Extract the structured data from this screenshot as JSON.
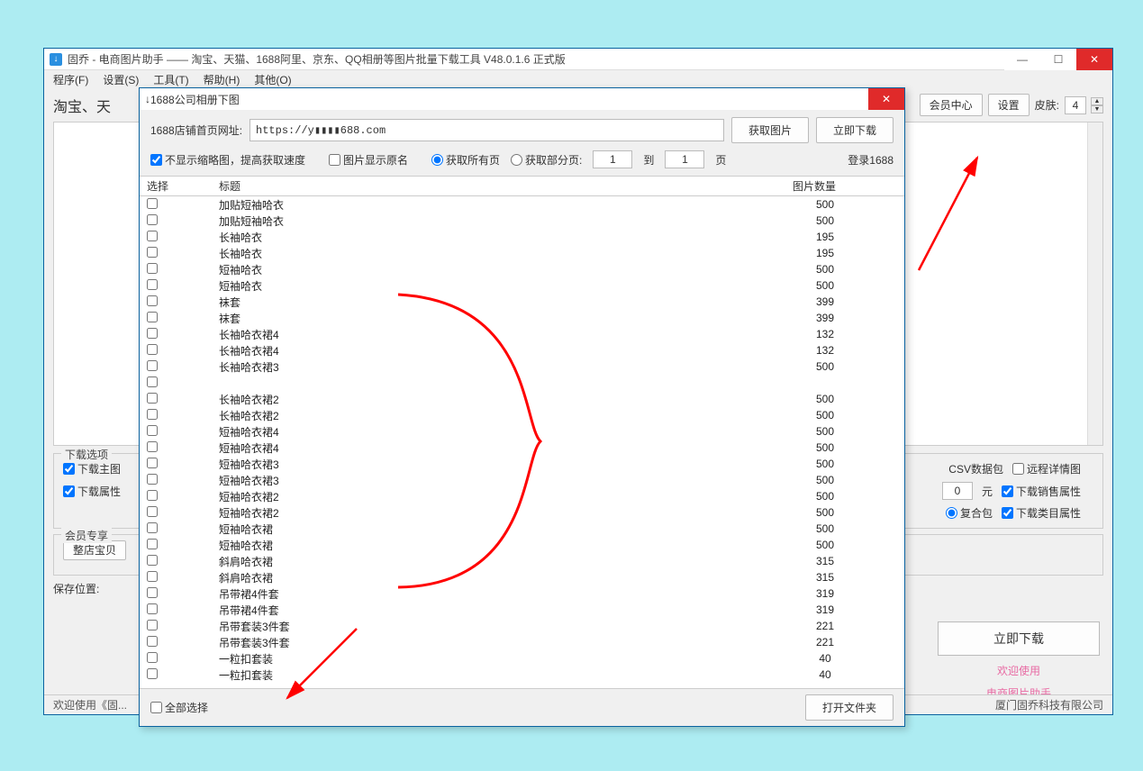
{
  "parent": {
    "title": "固乔 - 电商图片助手 —— 淘宝、天猫、1688阿里、京东、QQ相册等图片批量下载工具 V48.0.1.6 正式版",
    "menu": [
      "程序(F)",
      "设置(S)",
      "工具(T)",
      "帮助(H)",
      "其他(O)"
    ],
    "label_big_prefix": "淘宝、天",
    "toolbar": {
      "member_center": "会员中心",
      "settings": "设置",
      "skin_label": "皮肤:",
      "skin_value": "4"
    },
    "options_group": {
      "title": "下载选项",
      "chk_main": "下载主图",
      "chk_attr": "下载属性",
      "csv_label": "CSV数据包",
      "remote_detail": "远程详情图",
      "price_input": "0",
      "price_unit": "元",
      "dl_sale_attr": "下载销售属性",
      "compound_pack": "复合包",
      "dl_cat_attr": "下载类目属性"
    },
    "member_group": {
      "title": "会员专享",
      "btn_whole_store": "整店宝贝"
    },
    "save_loc_label": "保存位置:",
    "big_download": "立即下载",
    "welcome1": "欢迎使用",
    "welcome2": "电商图片助手",
    "status_left": "欢迎使用《固...",
    "status_right": "厦门固乔科技有限公司"
  },
  "modal": {
    "title": "1688公司相册下图",
    "url_label": "1688店铺首页网址:",
    "url_value": "https://y▮▮▮▮688.com",
    "btn_fetch": "获取图片",
    "btn_download": "立即下载",
    "chk_no_thumb": "不显示缩略图，提高获取速度",
    "chk_show_orig": "图片显示原名",
    "radio_all": "获取所有页",
    "radio_part": "获取部分页:",
    "page_from": "1",
    "to_label": "到",
    "page_to": "1",
    "page_unit": "页",
    "login_link": "登录1688",
    "headers": {
      "select": "选择",
      "title": "标题",
      "count": "图片数量"
    },
    "rows": [
      {
        "title": "加贴短袖哈衣",
        "count": "500"
      },
      {
        "title": "加贴短袖哈衣",
        "count": "500"
      },
      {
        "title": "长袖哈衣",
        "count": "195"
      },
      {
        "title": "长袖哈衣",
        "count": "195"
      },
      {
        "title": "短袖哈衣",
        "count": "500"
      },
      {
        "title": "短袖哈衣",
        "count": "500"
      },
      {
        "title": "袜套",
        "count": "399"
      },
      {
        "title": "袜套",
        "count": "399"
      },
      {
        "title": "长袖哈衣裙4",
        "count": "132"
      },
      {
        "title": "长袖哈衣裙4",
        "count": "132"
      },
      {
        "title": "长袖哈衣裙3",
        "count": "500"
      },
      {
        "title": "",
        "count": ""
      },
      {
        "title": "长袖哈衣裙2",
        "count": "500"
      },
      {
        "title": "长袖哈衣裙2",
        "count": "500"
      },
      {
        "title": "短袖哈衣裙4",
        "count": "500"
      },
      {
        "title": "短袖哈衣裙4",
        "count": "500"
      },
      {
        "title": "短袖哈衣裙3",
        "count": "500"
      },
      {
        "title": "短袖哈衣裙3",
        "count": "500"
      },
      {
        "title": "短袖哈衣裙2",
        "count": "500"
      },
      {
        "title": "短袖哈衣裙2",
        "count": "500"
      },
      {
        "title": "短袖哈衣裙",
        "count": "500"
      },
      {
        "title": "短袖哈衣裙",
        "count": "500"
      },
      {
        "title": "斜肩哈衣裙",
        "count": "315"
      },
      {
        "title": "斜肩哈衣裙",
        "count": "315"
      },
      {
        "title": "吊带裙4件套",
        "count": "319"
      },
      {
        "title": "吊带裙4件套",
        "count": "319"
      },
      {
        "title": "吊带套装3件套",
        "count": "221"
      },
      {
        "title": "吊带套装3件套",
        "count": "221"
      },
      {
        "title": "一粒扣套装",
        "count": "40"
      },
      {
        "title": "一粒扣套装",
        "count": "40"
      }
    ],
    "select_all": "全部选择",
    "open_folder": "打开文件夹"
  }
}
